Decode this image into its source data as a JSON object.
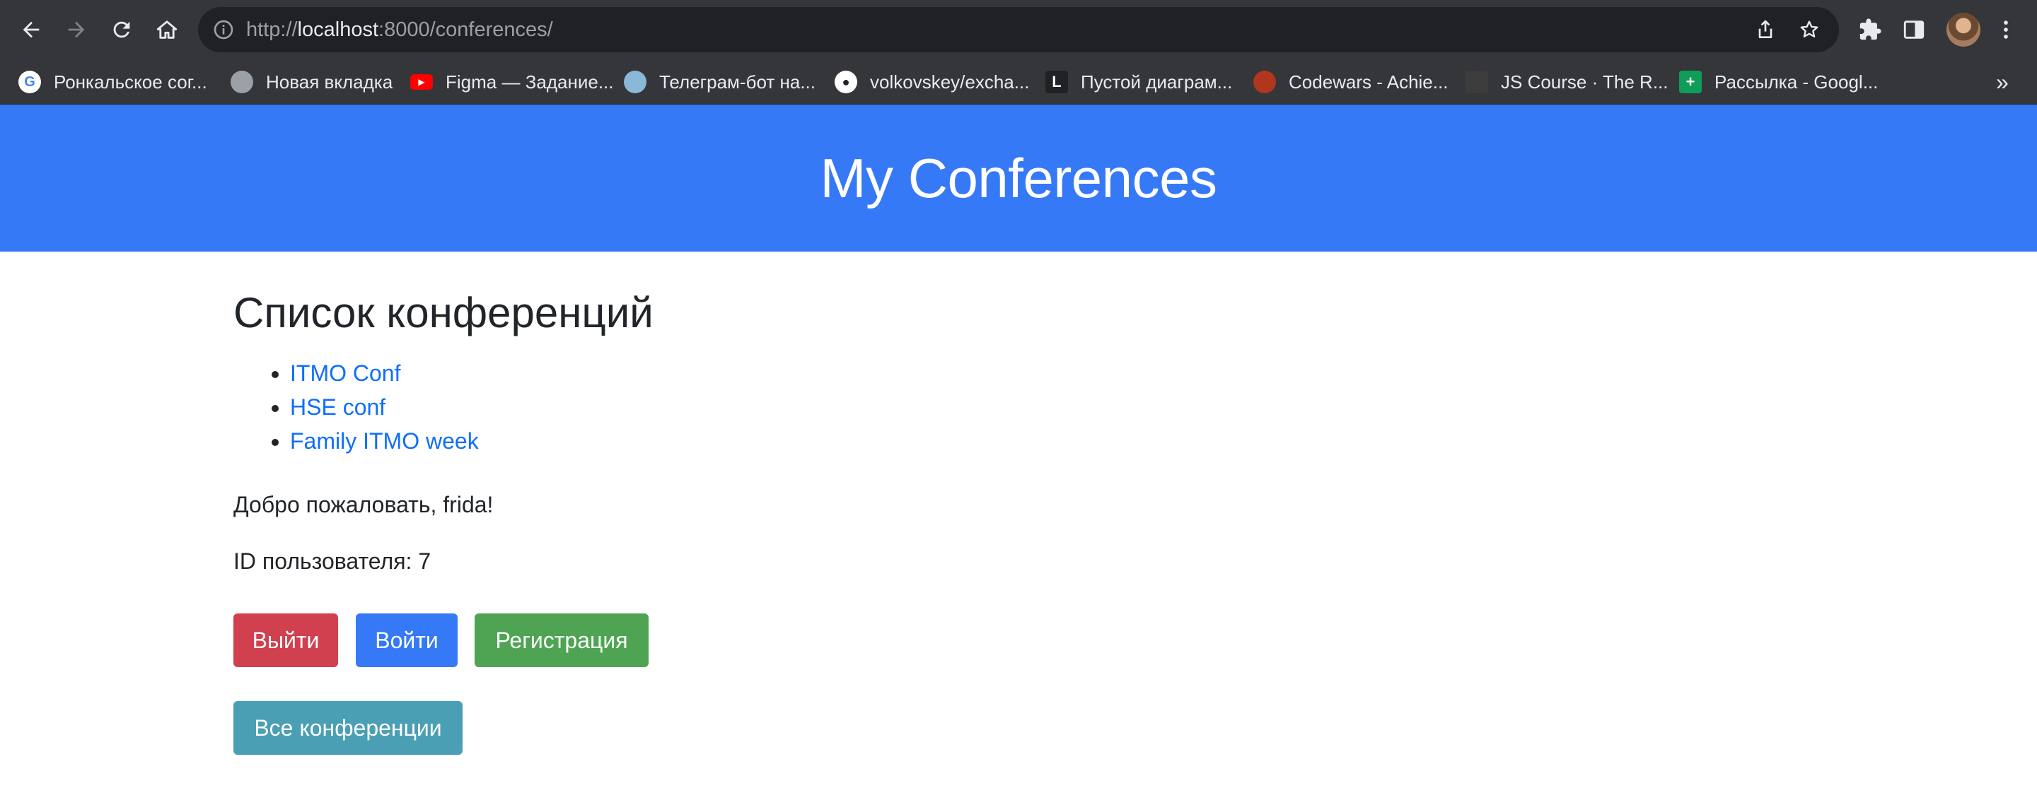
{
  "browser": {
    "url_scheme": "http://",
    "url_host": "localhost",
    "url_path": ":8000/conferences/",
    "bookmarks": [
      {
        "label": "Ронкальское сог...",
        "icon": "google-icon",
        "color": "#ffffff"
      },
      {
        "label": "Новая вкладка",
        "icon": "globe-icon",
        "color": "#9aa0a6"
      },
      {
        "label": "Figma — Задание...",
        "icon": "youtube-icon",
        "color": "#ff0000"
      },
      {
        "label": "Телеграм-бот на...",
        "icon": "telegram-avatar-icon",
        "color": "#8bb8d6"
      },
      {
        "label": "volkovskey/excha...",
        "icon": "github-icon",
        "color": "#ffffff"
      },
      {
        "label": "Пустой диаграм...",
        "icon": "diagram-icon",
        "color": "#202124"
      },
      {
        "label": "Codewars - Achie...",
        "icon": "codewars-icon",
        "color": "#b1361e"
      },
      {
        "label": "JS Course · The R...",
        "icon": "js-course-icon",
        "color": "#3c3c3c"
      },
      {
        "label": "Рассылка - Googl...",
        "icon": "google-sheets-icon",
        "color": "#0f9d58"
      }
    ],
    "more_label": "»"
  },
  "header": {
    "title": "My Conferences",
    "bg_color": "#3679f7"
  },
  "main": {
    "heading": "Список конференций",
    "conferences": [
      "ITMO Conf",
      "HSE conf",
      "Family ITMO week"
    ],
    "welcome_text": "Добро пожаловать, frida!",
    "user_id_text": "ID пользователя: 7",
    "buttons": {
      "logout": "Выйти",
      "login": "Войти",
      "register": "Регистрация",
      "all_conferences": "Все конференции"
    }
  }
}
